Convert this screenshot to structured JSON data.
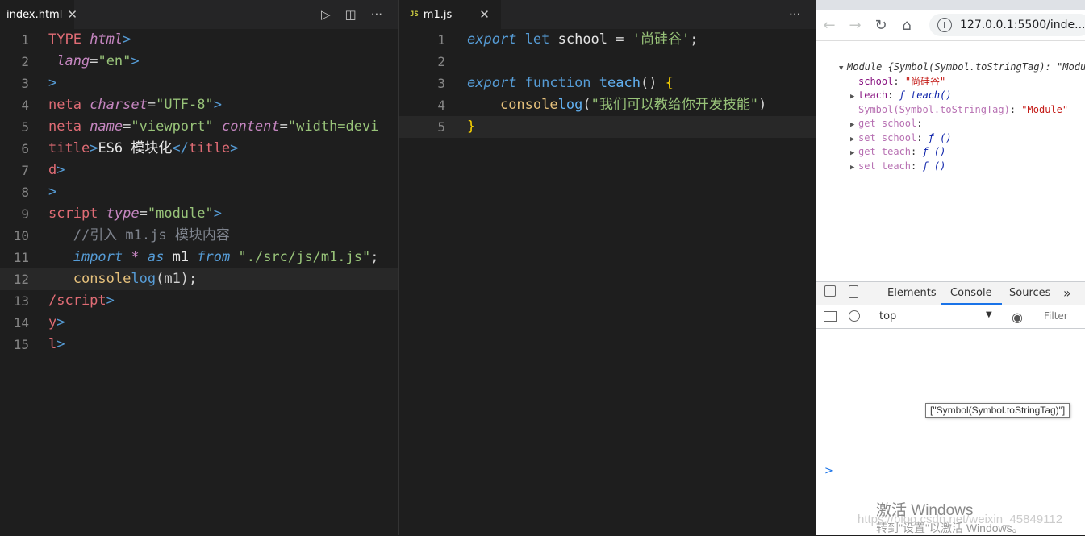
{
  "left_editor": {
    "tab_label": "index.html",
    "close_glyph": "✕",
    "lines": [
      {
        "n": "1"
      },
      {
        "n": "2"
      },
      {
        "n": "3"
      },
      {
        "n": "4"
      },
      {
        "n": "5"
      },
      {
        "n": "6"
      },
      {
        "n": "7"
      },
      {
        "n": "8"
      },
      {
        "n": "9"
      },
      {
        "n": "10"
      },
      {
        "n": "11"
      },
      {
        "n": "12"
      },
      {
        "n": "13"
      },
      {
        "n": "14"
      },
      {
        "n": "15"
      }
    ],
    "code": {
      "l1_a": "TYPE ",
      "l1_b": "html",
      ">": ">",
      "l2_a": "lang",
      "l2_b": "=",
      "l2_c": "\"en\"",
      "l2_d": ">",
      "l3_a": ">",
      "l4_a": "neta ",
      "l4_b": "charset",
      "l4_c": "=",
      "l4_d": "\"UTF-8\"",
      "l4_e": ">",
      "l5_a": "neta ",
      "l5_b": "name",
      "l5_c": "=",
      "l5_d": "\"viewport\"",
      "l5_e": " content",
      "l5_f": "=",
      "l5_g": "\"width=devi",
      "l6_a": "title",
      "l6_b": ">",
      "l6_c": "ES6 模块化",
      "l6_d": "</",
      "l6_e": "title",
      "l6_f": ">",
      "l7_a": "d",
      "l7_b": ">",
      "l8_a": ">",
      "l9_a": "script ",
      "l9_b": "type",
      "l9_c": "=",
      "l9_d": "\"module\"",
      "l9_e": ">",
      "l10_a": "//引入 m1.js 模块内容",
      "l11_a": "import",
      "l11_b": " * ",
      "l11_c": "as",
      "l11_d": " m1 ",
      "l11_e": "from",
      "l11_f": " \"./src/js/m1.js\"",
      ";": ";",
      "l12_a": "console",
      ".": ".",
      "l12_b": "log",
      "l12_c": "(m1);",
      "l13_a": "/script",
      "l13_b": ">",
      "l14_a": "y",
      "l14_b": ">",
      "l15_a": "l",
      "l15_b": ">"
    }
  },
  "right_editor": {
    "tab_label": "m1.js",
    "js_badge": "JS",
    "close_glyph": "✕",
    "more_glyph": "···",
    "lines": [
      {
        "n": "1"
      },
      {
        "n": "2"
      },
      {
        "n": "3"
      },
      {
        "n": "4"
      },
      {
        "n": "5"
      }
    ],
    "code": {
      "l1_a": "export",
      "l1_b": " let ",
      "l1_c": "school",
      "l1_d": " = ",
      "l1_e": "'尚硅谷'",
      "l1_f": ";",
      "l3_a": "export",
      "l3_b": " function ",
      "l3_c": "teach",
      "l3_d": "() ",
      "l3_e": "{",
      "l4_a": "console",
      ".": ".",
      "l4_b": "log",
      "l4_c": "(",
      "l4_d": "\"我们可以教给你开发技能\"",
      "l4_e": ")",
      "l5_a": "}"
    }
  },
  "toolbar": {
    "run": "▷",
    "split": "◫",
    "more": "···"
  },
  "browser": {
    "url": "127.0.0.1:5500/inde...",
    "info_glyph": "i",
    "back": "←",
    "forward": "→",
    "reload": "↻",
    "home": "⌂"
  },
  "devtools": {
    "tabs": [
      "Elements",
      "Console",
      "Sources"
    ],
    "more_tabs": "»",
    "context": "top",
    "filter_placeholder": "Filter",
    "console_lines": {
      "module_head": "Module {Symbol(Symbol.toStringTag): \"Modu",
      "school_key": "school",
      "school_val": "\"尚硅谷\"",
      "teach_key": "teach",
      "teach_val": "ƒ teach()",
      "sym_key": "Symbol(Symbol.toStringTag)",
      "sym_val": "\"Module\"",
      "get_school": "get school",
      "set_school": "set school",
      "set_school_val": "ƒ ()",
      "get_teach": "get teach",
      "get_teach_val": "ƒ ()",
      "set_teach": "set teach",
      "set_teach_val": "ƒ ()"
    },
    "tooltip": "[\"Symbol(Symbol.toStringTag)\"]",
    "prompt": ">"
  },
  "watermark": {
    "line1": "激活 Windows",
    "line2": "转到\"设置\"以激活 Windows。",
    "line3": "https://blog.csdn.net/weixin_45849112"
  }
}
